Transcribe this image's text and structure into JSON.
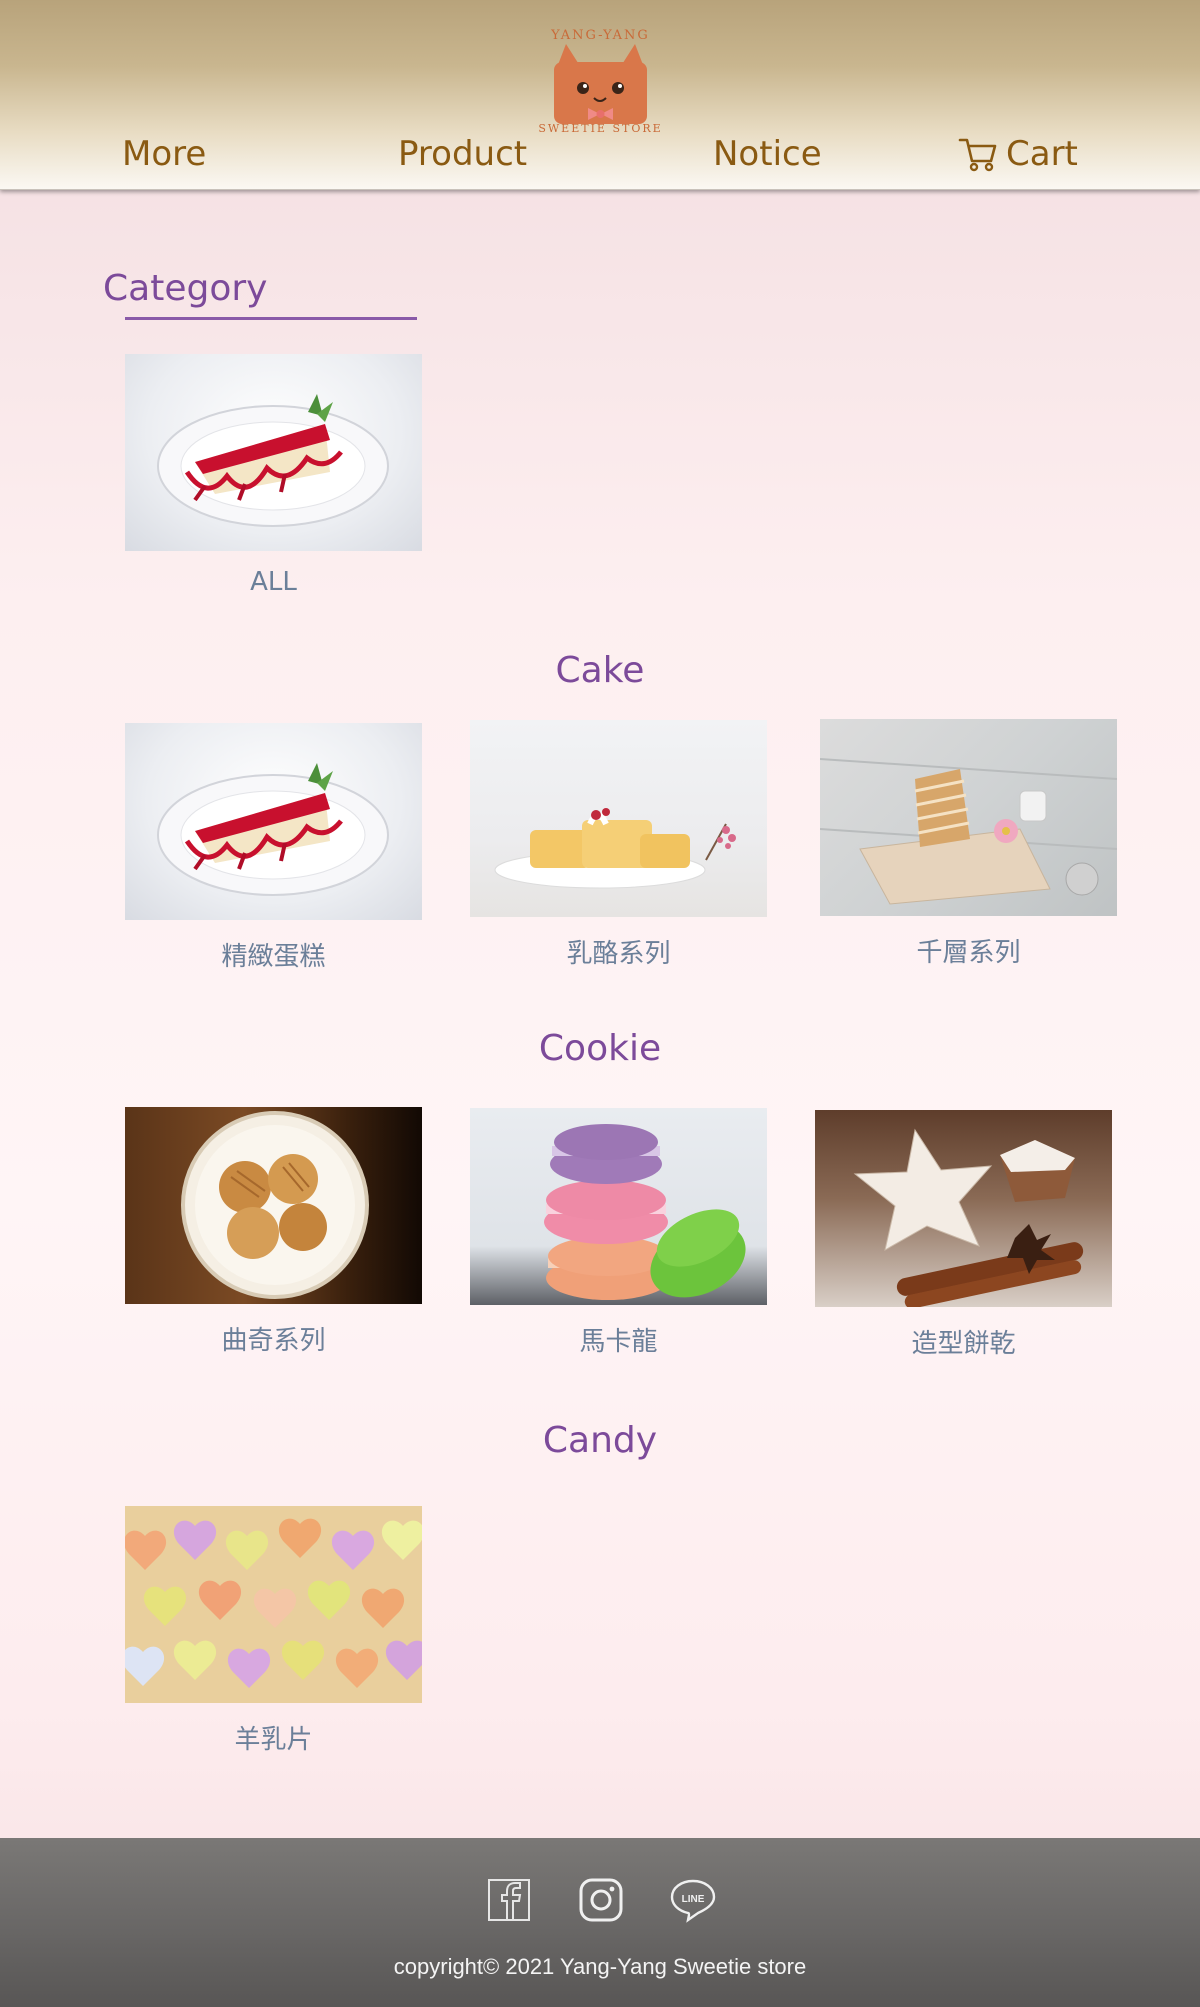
{
  "header": {
    "logo_top_text": "YANG-YANG",
    "logo_bottom_text": "SWEETIE STORE",
    "nav": {
      "more": "More",
      "product": "Product",
      "notice": "Notice",
      "cart": "Cart"
    }
  },
  "category": {
    "title": "Category",
    "all_label": "ALL"
  },
  "sections": {
    "cake": {
      "title": "Cake",
      "items": [
        "精緻蛋糕",
        "乳酪系列",
        "千層系列"
      ]
    },
    "cookie": {
      "title": "Cookie",
      "items": [
        "曲奇系列",
        "馬卡龍",
        "造型餅乾"
      ]
    },
    "candy": {
      "title": "Candy",
      "items": [
        "羊乳片"
      ]
    }
  },
  "footer": {
    "social_icons": [
      "facebook-icon",
      "instagram-icon",
      "line-icon"
    ],
    "copyright": "copyright© 2021 Yang-Yang Sweetie store"
  },
  "colors": {
    "nav_text": "#8a5a12",
    "heading": "#7c4a9a",
    "label": "#6b7f99",
    "logo": "#c96a38"
  }
}
